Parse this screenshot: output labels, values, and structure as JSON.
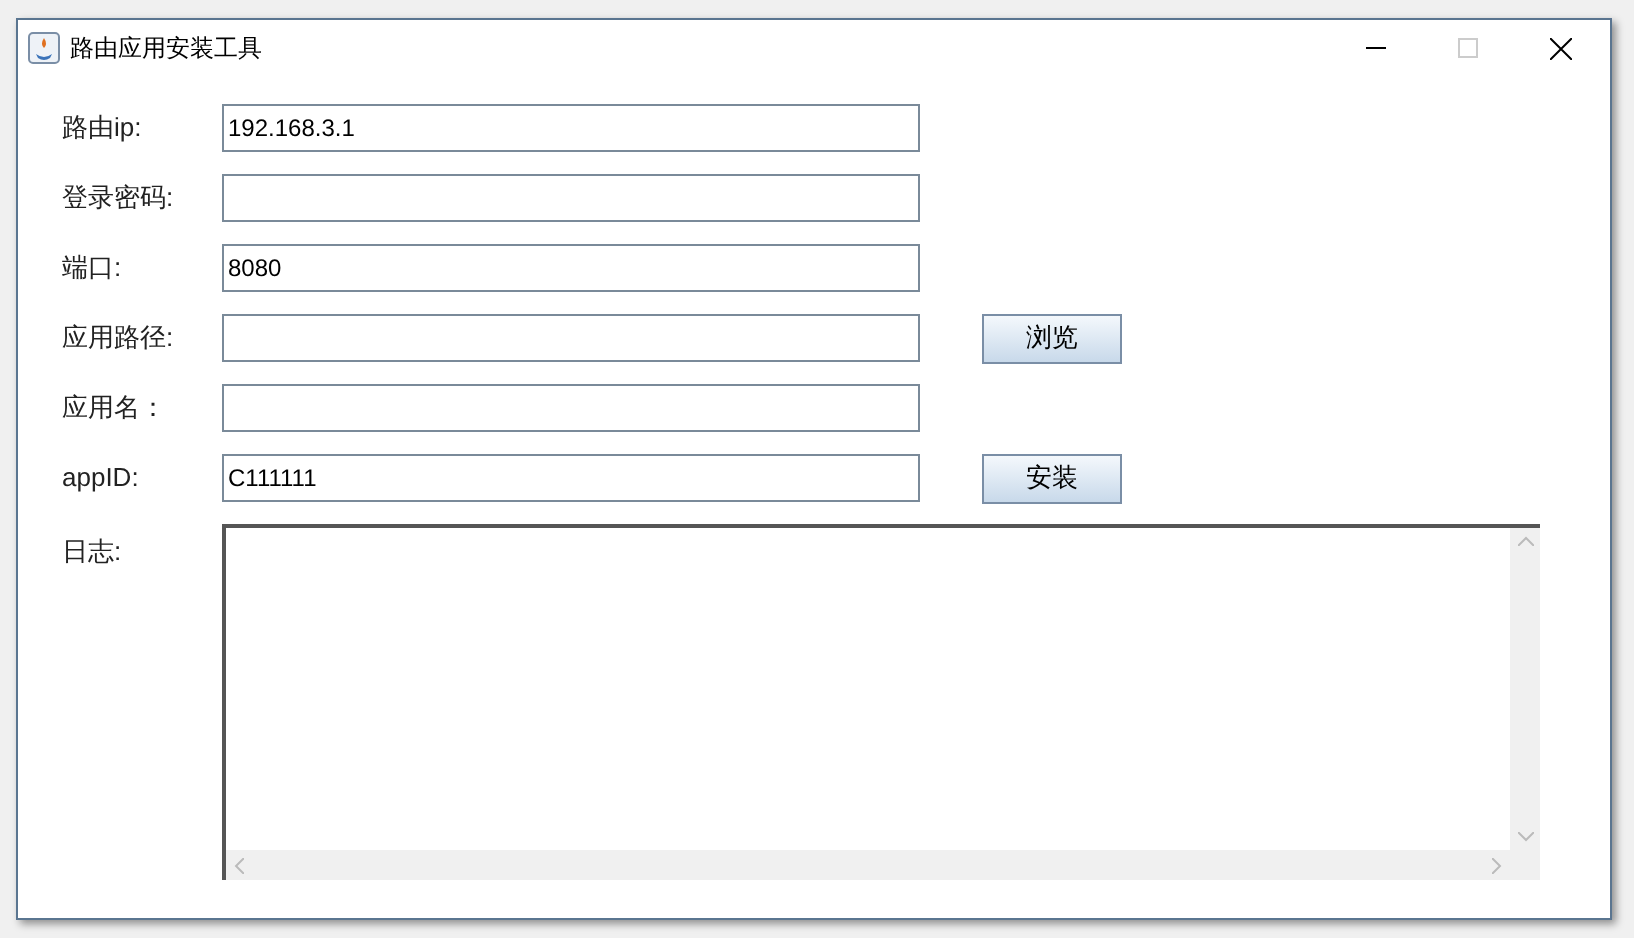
{
  "window": {
    "title": "路由应用安装工具"
  },
  "rows": [
    {
      "label": "路由ip:",
      "value": "192.168.3.1"
    },
    {
      "label": "登录密码:"
    },
    {
      "label": "端口:",
      "value": "8080"
    },
    {
      "label": "应用路径:",
      "button": "浏览"
    },
    {
      "label": "应用名："
    },
    {
      "label": "appID:",
      "value": "C111111",
      "button": "安装"
    }
  ],
  "log": {
    "label": "日志:"
  }
}
